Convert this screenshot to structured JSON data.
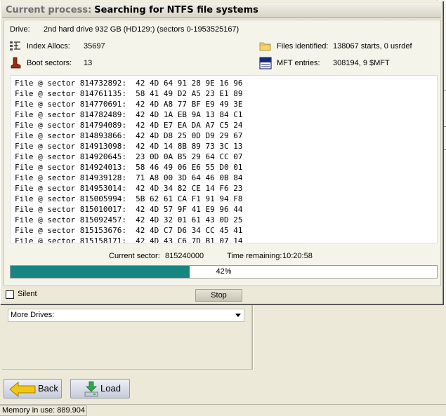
{
  "dialog": {
    "title_prefix": "Current process:",
    "title_main": "Searching for NTFS file systems"
  },
  "drive": {
    "label": "Drive:",
    "value": "2nd hard drive 932 GB (HD129:) (sectors 0-1953525167)"
  },
  "stats": {
    "index_allocs_label": "Index Allocs:",
    "index_allocs_value": "35697",
    "boot_sectors_label": "Boot sectors:",
    "boot_sectors_value": "13",
    "files_identified_label": "Files identified:",
    "files_identified_value": "138067 starts, 0 usrdef",
    "mft_entries_label": "MFT entries:",
    "mft_entries_value": "308194, 9 $MFT"
  },
  "icons": {
    "index_allocs": "index-alloc-icon",
    "boot_sectors": "boot-icon",
    "files_identified": "folder-icon",
    "mft_entries": "file-icon"
  },
  "log": [
    "File @ sector 814732892:  42 4D 64 91 28 9E 16 96",
    "File @ sector 814761135:  58 41 49 D2 A5 23 E1 89",
    "File @ sector 814770691:  42 4D A8 77 BF E9 49 3E",
    "File @ sector 814782489:  42 4D 1A EB 9A 13 84 C1",
    "File @ sector 814794089:  42 4D E7 EA DA A7 C5 24",
    "File @ sector 814893866:  42 4D D8 25 0D D9 29 67",
    "File @ sector 814913098:  42 4D 14 8B 89 73 3C 13",
    "File @ sector 814920645:  23 0D 0A B5 29 64 CC 07",
    "File @ sector 814924013:  58 46 49 06 E6 55 D0 01",
    "File @ sector 814939128:  71 A8 00 3D 64 46 0B 84",
    "File @ sector 814953014:  42 4D 34 82 CE 14 F6 23",
    "File @ sector 815005994:  5B 62 61 CA F1 91 94 F8",
    "File @ sector 815010017:  42 4D 57 9F 41 E9 96 44",
    "File @ sector 815092457:  42 4D 32 01 61 43 0D 25",
    "File @ sector 815153676:  42 4D C7 D6 34 CC 45 41",
    "File @ sector 815158171:  42 4D 43 C6 7D B1 07 14"
  ],
  "progress": {
    "current_sector_label": "Current sector:",
    "current_sector_value": "815240000",
    "time_remaining_label": "Time remaining:",
    "time_remaining_value": "10:20:58",
    "percent_text": "42%",
    "fraction": 0.42,
    "bar_color": "#178581"
  },
  "controls": {
    "silent_label": "Silent",
    "silent_checked": false,
    "stop_label": "Stop"
  },
  "more_drives": {
    "selected": "More Drives:"
  },
  "buttons": {
    "back_label": "Back",
    "load_label": "Load"
  },
  "status": {
    "memory_text": "Memory in use: 889.904"
  }
}
